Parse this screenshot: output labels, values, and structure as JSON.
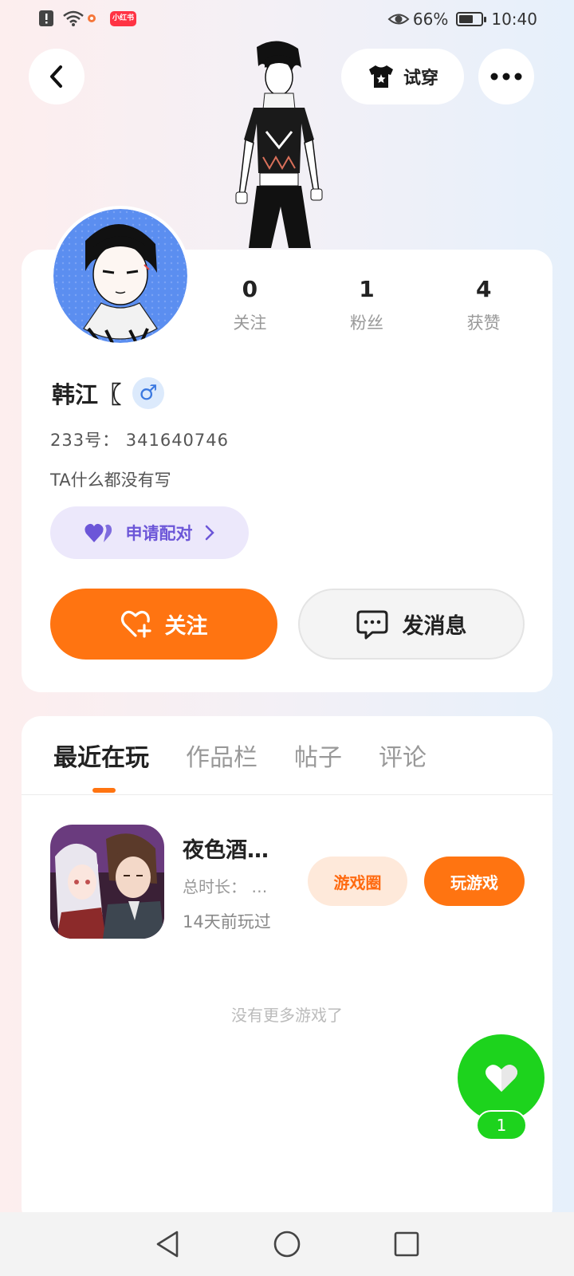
{
  "status_bar": {
    "app_badge": "小红书",
    "battery_percent": "66%",
    "battery_level": 0.66,
    "time": "10:40"
  },
  "header": {
    "tryon_label": "试穿"
  },
  "profile": {
    "stats": [
      {
        "value": "0",
        "label": "关注"
      },
      {
        "value": "1",
        "label": "粉丝"
      },
      {
        "value": "4",
        "label": "获赞"
      }
    ],
    "name": "韩江〖",
    "gender_symbol": "♂",
    "uid": "233号：  341640746",
    "bio": "TA什么都没有写",
    "pair_label": "申请配对",
    "follow_label": "关注",
    "message_label": "发消息"
  },
  "tabs": [
    {
      "label": "最近在玩",
      "active": true
    },
    {
      "label": "作品栏",
      "active": false
    },
    {
      "label": "帖子",
      "active": false
    },
    {
      "label": "评论",
      "active": false
    }
  ],
  "games": [
    {
      "title": "夜色酒…",
      "duration": "总时长：  …",
      "last_played": "14天前玩过",
      "circle_label": "游戏圈",
      "play_label": "玩游戏"
    }
  ],
  "no_more_text": "没有更多游戏了",
  "like": {
    "count": "1"
  },
  "colors": {
    "accent": "#ff7411",
    "like_green": "#1dd31d",
    "pair_purple": "#6c56d8"
  }
}
